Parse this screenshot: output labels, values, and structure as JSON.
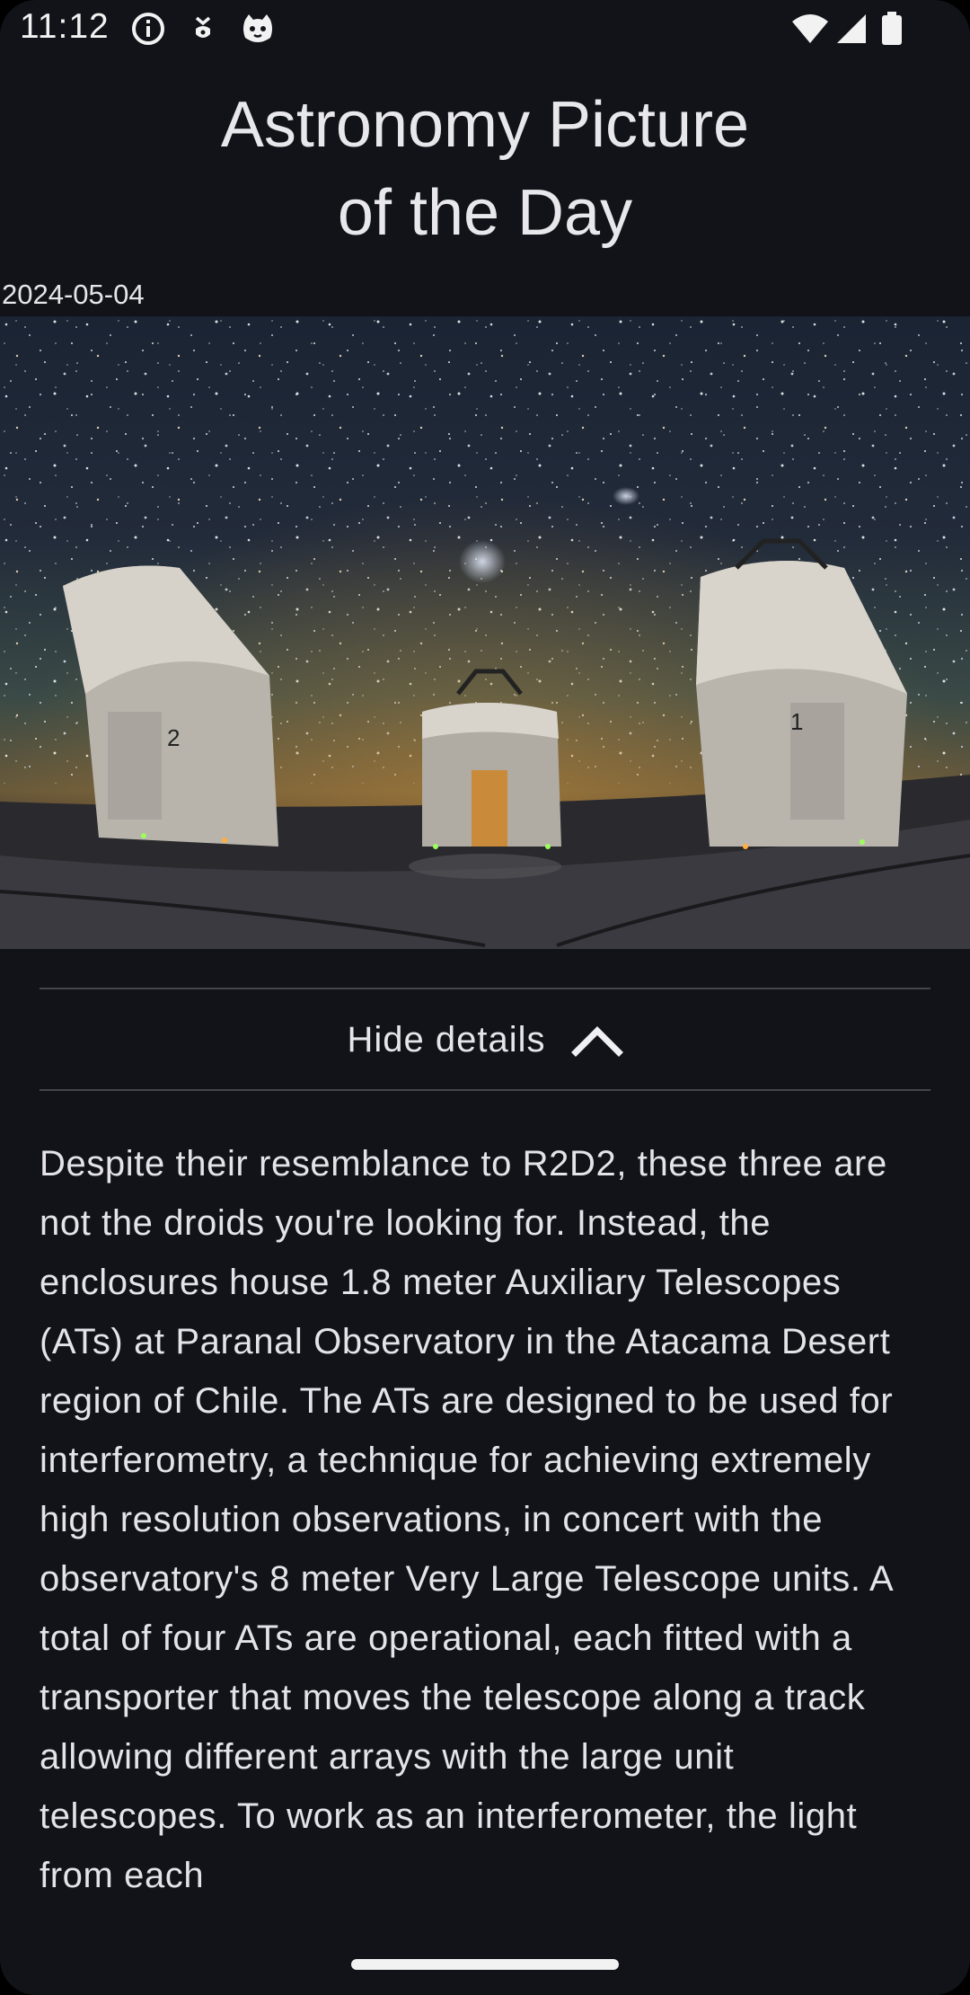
{
  "status_bar": {
    "time": "11:12",
    "icons": [
      "info-icon",
      "usb-debug-icon",
      "cat-face-icon",
      "wifi-icon",
      "signal-icon",
      "battery-icon"
    ]
  },
  "app": {
    "title_line1": "Astronomy Picture",
    "title_line2": "of the Day"
  },
  "apod": {
    "date": "2024-05-04",
    "image_alt": "",
    "toggle_label": "Hide details",
    "toggle_icon": "chevron-up-icon",
    "explanation": "Despite their resemblance to R2D2, these three are not the droids you're looking for. Instead, the enclosures house 1.8 meter Auxiliary Telescopes (ATs) at Paranal Observatory in the Atacama Desert region of Chile. The ATs are designed to be used for interferometry, a technique for achieving extremely high resolution observations, in concert with the observatory's 8 meter Very Large Telescope units. A total of four ATs are operational, each fitted with a transporter that moves the telescope along a track allowing different arrays with the large unit telescopes. To work as an interferometer, the light from each"
  },
  "colors": {
    "background": "#121318",
    "text": "#e6e6ea",
    "divider": "#44464e"
  }
}
